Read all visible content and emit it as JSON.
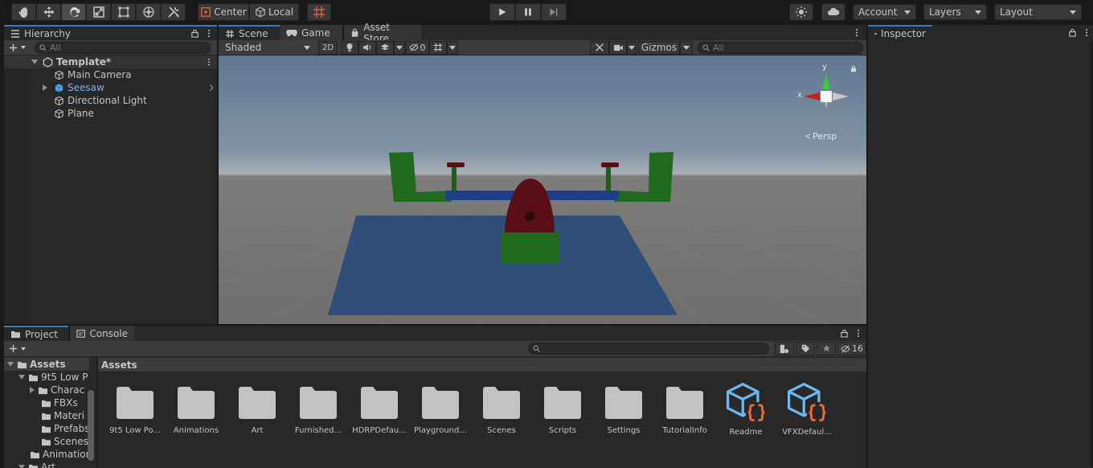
{
  "toolbar": {
    "tools": [
      "hand-tool",
      "move-tool",
      "rotate-tool",
      "scale-tool",
      "rect-tool",
      "transform-tool",
      "custom-tool"
    ],
    "pivot_mode": "Center",
    "pivot_rotation": "Local",
    "account": "Account",
    "layers": "Layers",
    "layout": "Layout"
  },
  "hierarchy": {
    "tab": "Hierarchy",
    "search_placeholder": "All",
    "scene_name": "Template*",
    "items": [
      {
        "label": "Main Camera",
        "selected": false
      },
      {
        "label": "Seesaw",
        "selected": true
      },
      {
        "label": "Directional Light",
        "selected": false
      },
      {
        "label": "Plane",
        "selected": false
      }
    ]
  },
  "scene": {
    "tabs": [
      "Scene",
      "Game",
      "Asset Store"
    ],
    "shading_mode": "Shaded",
    "mode_2d": "2D",
    "hidden_count": "0",
    "gizmos": "Gizmos",
    "search_placeholder": "All",
    "projection": "Persp",
    "axes": {
      "x": "x",
      "y": "y"
    }
  },
  "inspector": {
    "tab": "Inspector"
  },
  "project": {
    "tabs": [
      "Project",
      "Console"
    ],
    "hidden_count": "16",
    "breadcrumb": "Assets",
    "tree": [
      {
        "label": "Assets",
        "indent": 0
      },
      {
        "label": "9t5 Low P",
        "indent": 1
      },
      {
        "label": "Charac",
        "indent": 2
      },
      {
        "label": "FBXs",
        "indent": 2
      },
      {
        "label": "Materi",
        "indent": 2
      },
      {
        "label": "Prefabs",
        "indent": 2
      },
      {
        "label": "Scenes",
        "indent": 2
      },
      {
        "label": "Animation",
        "indent": 1
      },
      {
        "label": "Art",
        "indent": 1
      }
    ],
    "assets": [
      {
        "label": "9t5 Low Po...",
        "type": "folder"
      },
      {
        "label": "Animations",
        "type": "folder"
      },
      {
        "label": "Art",
        "type": "folder"
      },
      {
        "label": "Furnished...",
        "type": "folder"
      },
      {
        "label": "HDRPDefau...",
        "type": "folder"
      },
      {
        "label": "Playground...",
        "type": "folder"
      },
      {
        "label": "Scenes",
        "type": "folder"
      },
      {
        "label": "Scripts",
        "type": "folder"
      },
      {
        "label": "Settings",
        "type": "folder"
      },
      {
        "label": "TutorialInfo",
        "type": "folder"
      },
      {
        "label": "Readme",
        "type": "script-asset"
      },
      {
        "label": "VFXDefaul...",
        "type": "script-asset"
      }
    ]
  },
  "colors": {
    "accent": "#3a79bb",
    "selected_text": "#7fb0e8",
    "seesaw_green": "#1f6a1f",
    "seesaw_red": "#5a0f17",
    "seesaw_blue": "#1e3f8a",
    "plane_blue": "#2f4e7a"
  }
}
